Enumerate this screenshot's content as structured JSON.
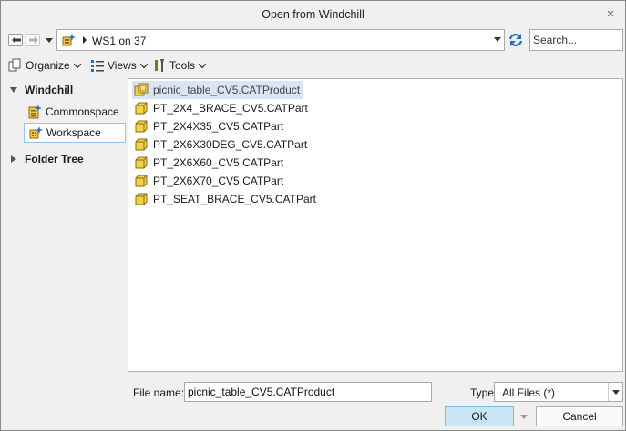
{
  "window": {
    "title": "Open from Windchill",
    "close_glyph": "×"
  },
  "navigation": {
    "back_icon": "arrow-left-icon",
    "forward_icon": "arrow-right-icon",
    "address_path": "WS1 on 37",
    "search_placeholder": "Search..."
  },
  "toolbar": {
    "organize_label": "Organize",
    "views_label": "Views",
    "tools_label": "Tools"
  },
  "sidebar": {
    "windchill_label": "Windchill",
    "locations": [
      {
        "label": "Commonspace",
        "icon": "commonspace-icon"
      },
      {
        "label": "Workspace",
        "icon": "workspace-icon",
        "selected": true
      }
    ],
    "folder_tree_label": "Folder Tree"
  },
  "files": [
    {
      "name": "picnic_table_CV5.CATProduct",
      "type": "assembly",
      "selected": true
    },
    {
      "name": "PT_2X4_BRACE_CV5.CATPart",
      "type": "part"
    },
    {
      "name": "PT_2X4X35_CV5.CATPart",
      "type": "part"
    },
    {
      "name": "PT_2X6X30DEG_CV5.CATPart",
      "type": "part"
    },
    {
      "name": "PT_2X6X60_CV5.CATPart",
      "type": "part"
    },
    {
      "name": "PT_2X6X70_CV5.CATPart",
      "type": "part"
    },
    {
      "name": "PT_SEAT_BRACE_CV5.CATPart",
      "type": "part"
    }
  ],
  "bottom": {
    "file_name_label": "File name:",
    "file_name_value": "picnic_table_CV5.CATProduct",
    "type_label": "Type",
    "type_value": "All Files (*)",
    "ok_label": "OK",
    "cancel_label": "Cancel"
  },
  "colors": {
    "selection": "#d9e5f2",
    "ok_button": "#c9e5f6",
    "part_icon_fill": "#f2d24a",
    "accent": "#1e73be"
  }
}
